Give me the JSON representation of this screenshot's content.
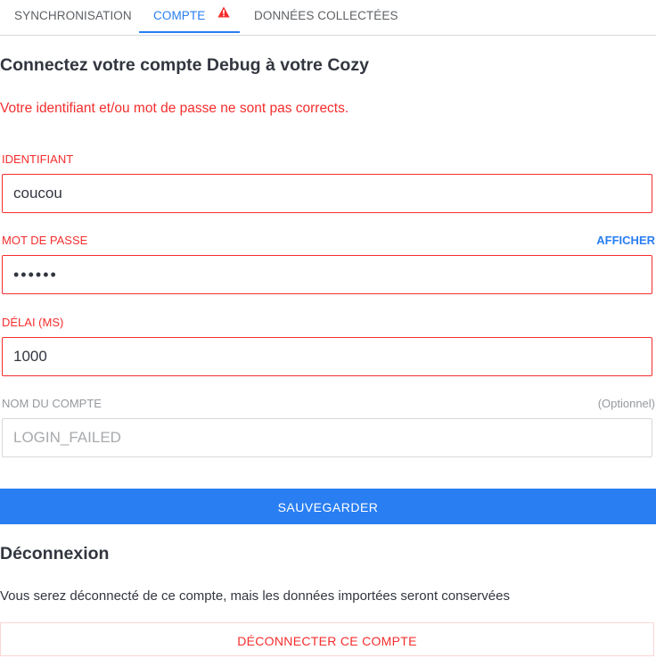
{
  "tabs": [
    {
      "label": "SYNCHRONISATION"
    },
    {
      "label": "COMPTE",
      "warning": "warning-icon"
    },
    {
      "label": "DONNÉES COLLECTÉES"
    }
  ],
  "form": {
    "title": "Connectez votre compte Debug à votre Cozy",
    "error": "Votre identifiant et/ou mot de passe ne sont pas corrects.",
    "login": {
      "label": "IDENTIFIANT",
      "value": "coucou"
    },
    "password": {
      "label": "MOT DE PASSE",
      "show_label": "AFFICHER",
      "value": "••••••"
    },
    "delay": {
      "label": "DÉLAI (MS)",
      "value": "1000"
    },
    "account_name": {
      "label": "NOM DU COMPTE",
      "optional": "(Optionnel)",
      "placeholder": "LOGIN_FAILED"
    },
    "save_label": "SAUVEGARDER"
  },
  "disconnect": {
    "title": "Déconnexion",
    "info": "Vous serez déconnecté de ce compte, mais les données importées seront conservées",
    "button_label": "DÉCONNECTER CE COMPTE"
  },
  "colors": {
    "accent": "#297ef2",
    "error": "#f52d2d"
  }
}
